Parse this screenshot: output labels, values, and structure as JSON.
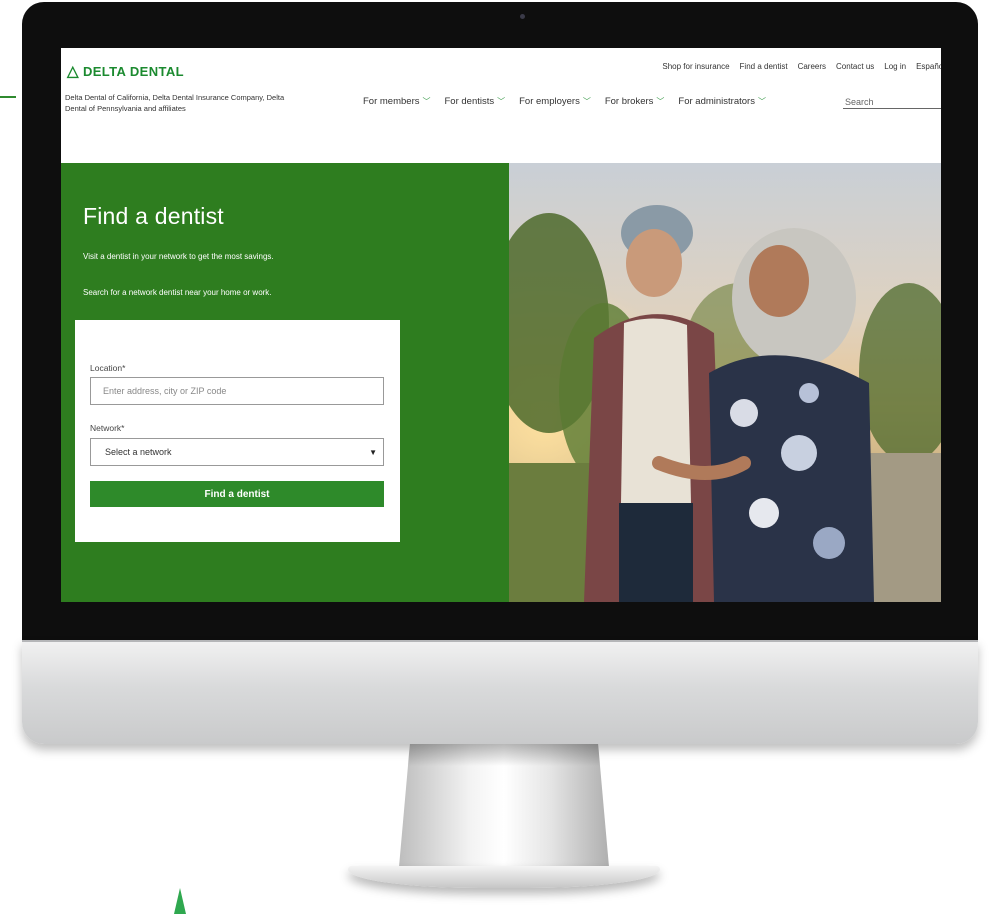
{
  "brand": {
    "logo_text": "DELTA DENTAL",
    "tagline": "Delta Dental of California, Delta Dental Insurance Company, Delta Dental of Pennsylvania and affiliates",
    "color_green": "#2e7d1f"
  },
  "utility_nav": [
    "Shop for insurance",
    "Find a dentist",
    "Careers",
    "Contact us",
    "Log in",
    "Español"
  ],
  "main_nav": [
    "For members",
    "For dentists",
    "For employers",
    "For brokers",
    "For administrators"
  ],
  "search": {
    "placeholder": "Search"
  },
  "hero": {
    "title": "Find a dentist",
    "subtitle_1": "Visit a dentist in your network to get the most savings.",
    "subtitle_2": "Search for a network dentist near your home or work."
  },
  "form": {
    "location_label": "Location*",
    "location_placeholder": "Enter address, city or ZIP code",
    "network_label": "Network*",
    "network_selected": "Select a network",
    "submit_label": "Find a dentist"
  }
}
